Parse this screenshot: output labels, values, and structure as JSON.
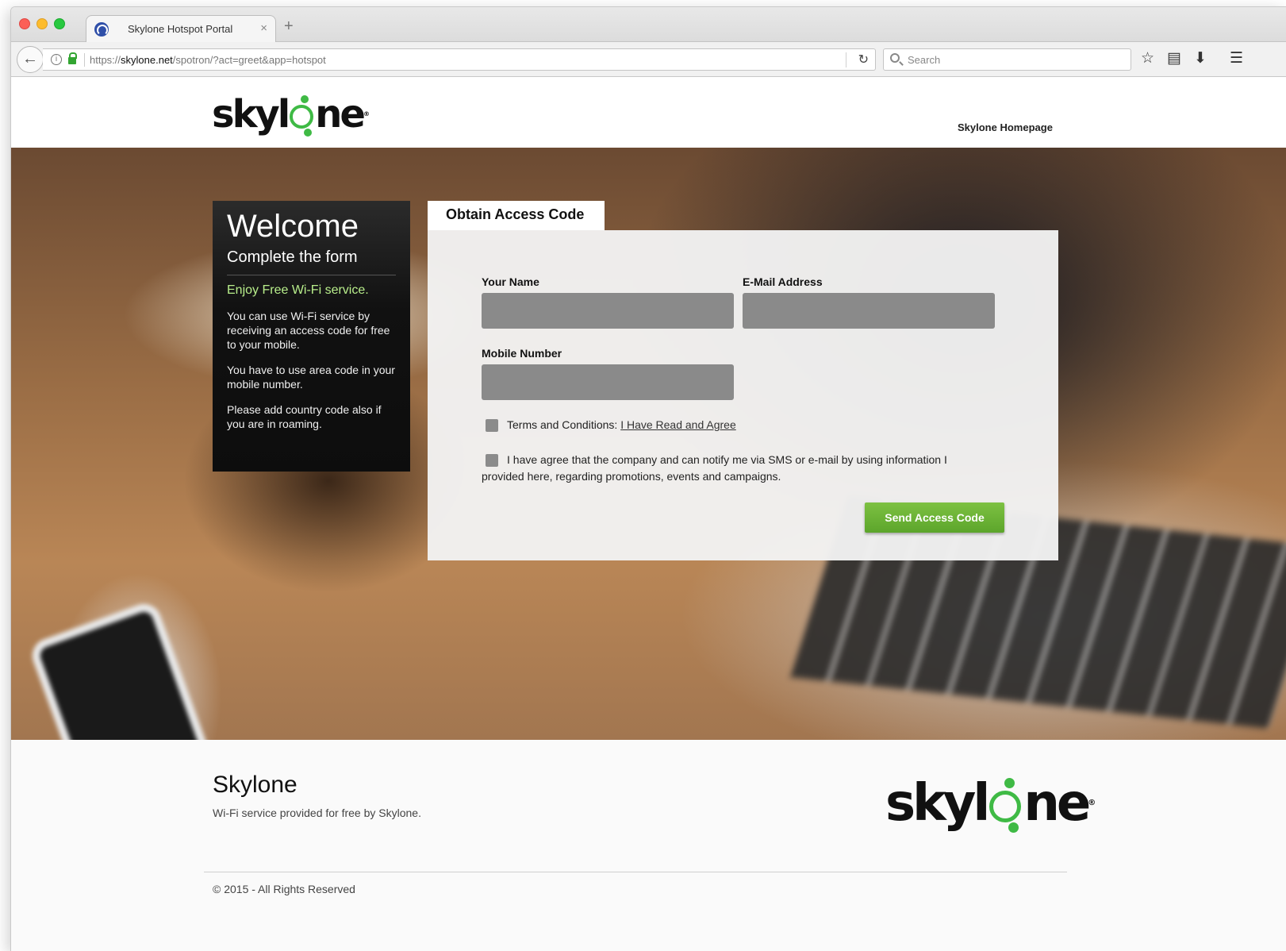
{
  "browser": {
    "tab_title": "Skylone Hotspot Portal",
    "tab_close": "×",
    "new_tab": "+",
    "url_prefix": "https://",
    "url_host": "skylone.net",
    "url_path": "/spotron/?act=greet&app=hotspot",
    "search_placeholder": "Search",
    "icons": [
      "back-arrow-icon",
      "info-icon",
      "lock-icon",
      "reload-icon",
      "search-icon",
      "star-icon",
      "reading-list-icon",
      "download-icon",
      "menu-icon"
    ]
  },
  "header": {
    "logo_prefix": "skyl",
    "logo_suffix": "ne",
    "logo_reg": "®",
    "homepage_link": "Skylone Homepage"
  },
  "welcome": {
    "title": "Welcome",
    "subtitle": "Complete the form",
    "enjoy": "Enjoy Free Wi-Fi service.",
    "p1": "You can use Wi-Fi service by receiving an access code for free to your mobile.",
    "p2": "You have to use area code in your mobile number.",
    "p3": "Please add country code also if you are in roaming."
  },
  "form": {
    "tab_label": "Obtain Access Code",
    "name_label": "Your Name",
    "name_value": "",
    "email_label": "E-Mail Address",
    "email_value": "",
    "mobile_label": "Mobile Number",
    "mobile_value": "",
    "terms_text": "Terms and Conditions:",
    "terms_link": "I Have Read and Agree",
    "terms_checked": false,
    "consent_text": "I have agree that the company and can notify me via SMS or e-mail by using information I provided here, regarding promotions, events and campaigns.",
    "consent_checked": false,
    "submit_label": "Send Access Code"
  },
  "footer": {
    "title": "Skylone",
    "subtitle": "Wi-Fi service provided for free by Skylone.",
    "copyright": "© 2015 - All Rights Reserved"
  },
  "colors": {
    "brand_green": "#3fba45",
    "button_green": "#6cb336",
    "enjoy_green": "#b8ee8b",
    "input_gray": "#8a8a8a"
  }
}
